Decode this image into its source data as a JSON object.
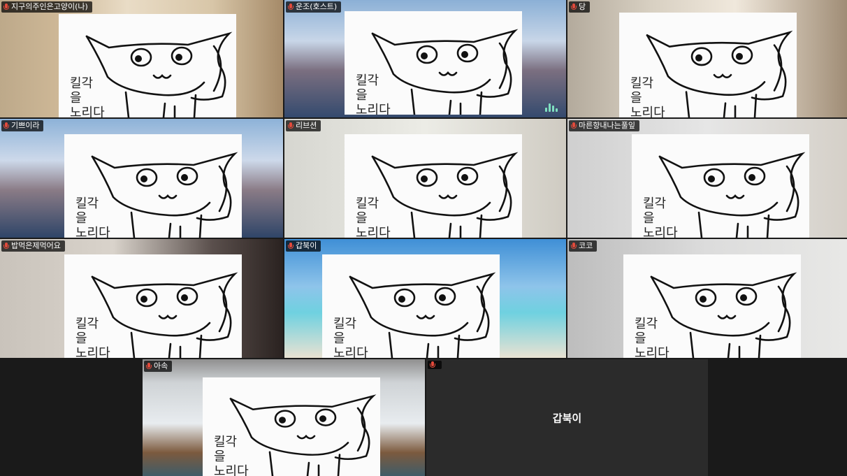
{
  "participants": [
    {
      "name": "지구의주인은고양이(나)",
      "note": "킬각\n을\n노리다"
    },
    {
      "name": "운조(호스트)",
      "note": "킬각\n을\n노리다"
    },
    {
      "name": "당",
      "note": "킬각\n을\n노리다"
    },
    {
      "name": "기쁘이라",
      "note": "킬각\n을\n노리다"
    },
    {
      "name": "리브션",
      "note": "킬각\n을\n노리다"
    },
    {
      "name": "마른향내나는풀잎",
      "note": "킬각\n을\n노리다"
    },
    {
      "name": "밥먹은제먹어요",
      "note": "킬각\n을\n노리다"
    },
    {
      "name": "갑북이",
      "note": "킬각\n을\n노리다"
    },
    {
      "name": "코코",
      "note": "킬각\n을\n노리다"
    },
    {
      "name": "아속",
      "note": "킬각\n을\n노리다"
    },
    {
      "name": "",
      "center_name": "갑북이"
    }
  ],
  "icons": {
    "muted": "mic-muted-icon",
    "speaking": "audio-level-icon"
  },
  "colors": {
    "active_speaker_border": "#2ee06a",
    "background": "#1a1a1a",
    "muted_icon": "#e24a3b"
  }
}
